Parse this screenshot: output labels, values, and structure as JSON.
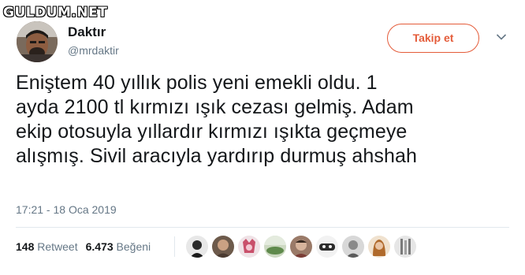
{
  "watermark": "GULDUM.NET",
  "author": {
    "display_name": "Daktır",
    "handle": "@mrdaktir"
  },
  "follow_button": {
    "label": "Takip et"
  },
  "tweet": {
    "lines": [
      "Eniştem 40 yıllık polis yeni emekli oldu. 1",
      "ayda 2100 tl kırmızı ışık cezası gelmiş. Adam",
      "ekip otosuyla yıllardır kırmızı ışıkta geçmeye",
      "alışmış. Sivil aracıyla yardırıp durmuş ahshah"
    ],
    "timestamp": "17:21 - 18 Oca 2019"
  },
  "stats": {
    "retweet_count": "148",
    "retweet_label": "Retweet",
    "like_count": "6.473",
    "like_label": "Beğeni"
  },
  "colors": {
    "accent": "#e45c3a",
    "secondary_text": "#657786",
    "divider": "#e1e8ed"
  },
  "icons": {
    "menu": "chevron-down-icon"
  }
}
